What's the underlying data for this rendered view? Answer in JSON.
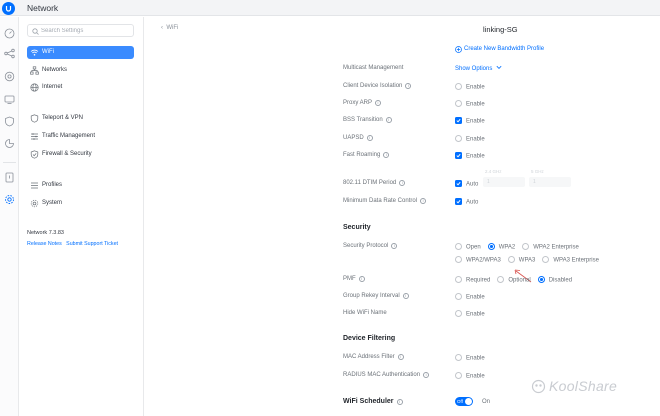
{
  "app": {
    "title": "Network"
  },
  "search": {
    "placeholder": "Search Settings"
  },
  "nav": {
    "items": [
      {
        "label": "WiFi",
        "icon": "wifi-icon",
        "active": true
      },
      {
        "label": "Networks",
        "icon": "networks-icon"
      },
      {
        "label": "Internet",
        "icon": "globe-icon"
      },
      {
        "label": "Teleport & VPN",
        "icon": "teleport-icon"
      },
      {
        "label": "Traffic Management",
        "icon": "traffic-icon"
      },
      {
        "label": "Firewall & Security",
        "icon": "shield-icon"
      },
      {
        "label": "Profiles",
        "icon": "profiles-icon"
      },
      {
        "label": "System",
        "icon": "system-icon"
      }
    ]
  },
  "footer": {
    "version": "Network 7.3.83",
    "release_notes": "Release Notes",
    "support": "Submit Support Ticket"
  },
  "main": {
    "breadcrumb": "WiFi",
    "ssid": "linking-SG",
    "create_profile": "Create New Bandwidth Profile",
    "multicast": {
      "label": "Multicast Management",
      "value": "Show Options"
    },
    "client_isolation": {
      "label": "Client Device Isolation",
      "value": "Enable"
    },
    "proxy_arp": {
      "label": "Proxy ARP",
      "value": "Enable"
    },
    "bss": {
      "label": "BSS Transition",
      "value": "Enable"
    },
    "uapsd": {
      "label": "UAPSD",
      "value": "Enable"
    },
    "fast_roaming": {
      "label": "Fast Roaming",
      "value": "Enable"
    },
    "dtim": {
      "label": "802.11 DTIM Period",
      "value": "Auto",
      "field1_label": "2.4 GHz",
      "field2_label": "5 GHz",
      "field1_value": "1",
      "field2_value": "1"
    },
    "min_rate": {
      "label": "Minimum Data Rate Control",
      "value": "Auto"
    },
    "security_title": "Security",
    "security_protocol": {
      "label": "Security Protocol",
      "options_row1": [
        "Open",
        "WPA2",
        "WPA2 Enterprise"
      ],
      "options_row2": [
        "WPA2/WPA3",
        "WPA3",
        "WPA3 Enterprise"
      ],
      "selected": "WPA2"
    },
    "pmf": {
      "label": "PMF",
      "options": [
        "Required",
        "Optional",
        "Disabled"
      ],
      "selected": "Disabled"
    },
    "group_rekey": {
      "label": "Group Rekey Interval",
      "value": "Enable"
    },
    "hide_wifi": {
      "label": "Hide WiFi Name",
      "value": "Enable"
    },
    "device_filtering_title": "Device Filtering",
    "mac_filter": {
      "label": "MAC Address Filter",
      "value": "Enable"
    },
    "radius_mac": {
      "label": "RADIUS MAC Authentication",
      "value": "Enable"
    },
    "scheduler": {
      "label": "WiFi Scheduler",
      "toggle_label": "Off",
      "state_text": "On"
    }
  },
  "watermark": "KoolShare",
  "colors": {
    "accent": "#006fff",
    "active_nav": "#3a8bff"
  }
}
